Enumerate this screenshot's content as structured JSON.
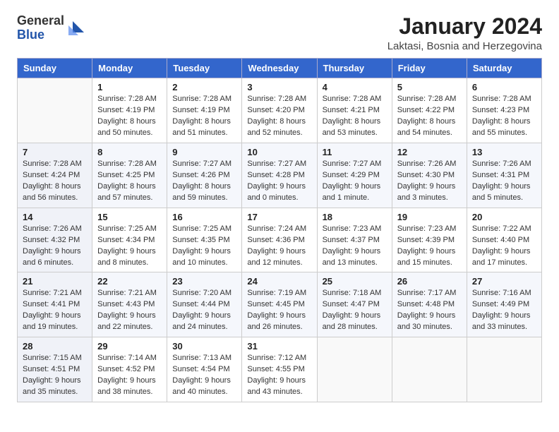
{
  "header": {
    "logo_general": "General",
    "logo_blue": "Blue",
    "title": "January 2024",
    "subtitle": "Laktasi, Bosnia and Herzegovina"
  },
  "days_of_week": [
    "Sunday",
    "Monday",
    "Tuesday",
    "Wednesday",
    "Thursday",
    "Friday",
    "Saturday"
  ],
  "weeks": [
    [
      {
        "day": "",
        "sunrise": "",
        "sunset": "",
        "daylight": ""
      },
      {
        "day": "1",
        "sunrise": "Sunrise: 7:28 AM",
        "sunset": "Sunset: 4:19 PM",
        "daylight": "Daylight: 8 hours and 50 minutes."
      },
      {
        "day": "2",
        "sunrise": "Sunrise: 7:28 AM",
        "sunset": "Sunset: 4:19 PM",
        "daylight": "Daylight: 8 hours and 51 minutes."
      },
      {
        "day": "3",
        "sunrise": "Sunrise: 7:28 AM",
        "sunset": "Sunset: 4:20 PM",
        "daylight": "Daylight: 8 hours and 52 minutes."
      },
      {
        "day": "4",
        "sunrise": "Sunrise: 7:28 AM",
        "sunset": "Sunset: 4:21 PM",
        "daylight": "Daylight: 8 hours and 53 minutes."
      },
      {
        "day": "5",
        "sunrise": "Sunrise: 7:28 AM",
        "sunset": "Sunset: 4:22 PM",
        "daylight": "Daylight: 8 hours and 54 minutes."
      },
      {
        "day": "6",
        "sunrise": "Sunrise: 7:28 AM",
        "sunset": "Sunset: 4:23 PM",
        "daylight": "Daylight: 8 hours and 55 minutes."
      }
    ],
    [
      {
        "day": "7",
        "sunrise": "Sunrise: 7:28 AM",
        "sunset": "Sunset: 4:24 PM",
        "daylight": "Daylight: 8 hours and 56 minutes."
      },
      {
        "day": "8",
        "sunrise": "Sunrise: 7:28 AM",
        "sunset": "Sunset: 4:25 PM",
        "daylight": "Daylight: 8 hours and 57 minutes."
      },
      {
        "day": "9",
        "sunrise": "Sunrise: 7:27 AM",
        "sunset": "Sunset: 4:26 PM",
        "daylight": "Daylight: 8 hours and 59 minutes."
      },
      {
        "day": "10",
        "sunrise": "Sunrise: 7:27 AM",
        "sunset": "Sunset: 4:28 PM",
        "daylight": "Daylight: 9 hours and 0 minutes."
      },
      {
        "day": "11",
        "sunrise": "Sunrise: 7:27 AM",
        "sunset": "Sunset: 4:29 PM",
        "daylight": "Daylight: 9 hours and 1 minute."
      },
      {
        "day": "12",
        "sunrise": "Sunrise: 7:26 AM",
        "sunset": "Sunset: 4:30 PM",
        "daylight": "Daylight: 9 hours and 3 minutes."
      },
      {
        "day": "13",
        "sunrise": "Sunrise: 7:26 AM",
        "sunset": "Sunset: 4:31 PM",
        "daylight": "Daylight: 9 hours and 5 minutes."
      }
    ],
    [
      {
        "day": "14",
        "sunrise": "Sunrise: 7:26 AM",
        "sunset": "Sunset: 4:32 PM",
        "daylight": "Daylight: 9 hours and 6 minutes."
      },
      {
        "day": "15",
        "sunrise": "Sunrise: 7:25 AM",
        "sunset": "Sunset: 4:34 PM",
        "daylight": "Daylight: 9 hours and 8 minutes."
      },
      {
        "day": "16",
        "sunrise": "Sunrise: 7:25 AM",
        "sunset": "Sunset: 4:35 PM",
        "daylight": "Daylight: 9 hours and 10 minutes."
      },
      {
        "day": "17",
        "sunrise": "Sunrise: 7:24 AM",
        "sunset": "Sunset: 4:36 PM",
        "daylight": "Daylight: 9 hours and 12 minutes."
      },
      {
        "day": "18",
        "sunrise": "Sunrise: 7:23 AM",
        "sunset": "Sunset: 4:37 PM",
        "daylight": "Daylight: 9 hours and 13 minutes."
      },
      {
        "day": "19",
        "sunrise": "Sunrise: 7:23 AM",
        "sunset": "Sunset: 4:39 PM",
        "daylight": "Daylight: 9 hours and 15 minutes."
      },
      {
        "day": "20",
        "sunrise": "Sunrise: 7:22 AM",
        "sunset": "Sunset: 4:40 PM",
        "daylight": "Daylight: 9 hours and 17 minutes."
      }
    ],
    [
      {
        "day": "21",
        "sunrise": "Sunrise: 7:21 AM",
        "sunset": "Sunset: 4:41 PM",
        "daylight": "Daylight: 9 hours and 19 minutes."
      },
      {
        "day": "22",
        "sunrise": "Sunrise: 7:21 AM",
        "sunset": "Sunset: 4:43 PM",
        "daylight": "Daylight: 9 hours and 22 minutes."
      },
      {
        "day": "23",
        "sunrise": "Sunrise: 7:20 AM",
        "sunset": "Sunset: 4:44 PM",
        "daylight": "Daylight: 9 hours and 24 minutes."
      },
      {
        "day": "24",
        "sunrise": "Sunrise: 7:19 AM",
        "sunset": "Sunset: 4:45 PM",
        "daylight": "Daylight: 9 hours and 26 minutes."
      },
      {
        "day": "25",
        "sunrise": "Sunrise: 7:18 AM",
        "sunset": "Sunset: 4:47 PM",
        "daylight": "Daylight: 9 hours and 28 minutes."
      },
      {
        "day": "26",
        "sunrise": "Sunrise: 7:17 AM",
        "sunset": "Sunset: 4:48 PM",
        "daylight": "Daylight: 9 hours and 30 minutes."
      },
      {
        "day": "27",
        "sunrise": "Sunrise: 7:16 AM",
        "sunset": "Sunset: 4:49 PM",
        "daylight": "Daylight: 9 hours and 33 minutes."
      }
    ],
    [
      {
        "day": "28",
        "sunrise": "Sunrise: 7:15 AM",
        "sunset": "Sunset: 4:51 PM",
        "daylight": "Daylight: 9 hours and 35 minutes."
      },
      {
        "day": "29",
        "sunrise": "Sunrise: 7:14 AM",
        "sunset": "Sunset: 4:52 PM",
        "daylight": "Daylight: 9 hours and 38 minutes."
      },
      {
        "day": "30",
        "sunrise": "Sunrise: 7:13 AM",
        "sunset": "Sunset: 4:54 PM",
        "daylight": "Daylight: 9 hours and 40 minutes."
      },
      {
        "day": "31",
        "sunrise": "Sunrise: 7:12 AM",
        "sunset": "Sunset: 4:55 PM",
        "daylight": "Daylight: 9 hours and 43 minutes."
      },
      {
        "day": "",
        "sunrise": "",
        "sunset": "",
        "daylight": ""
      },
      {
        "day": "",
        "sunrise": "",
        "sunset": "",
        "daylight": ""
      },
      {
        "day": "",
        "sunrise": "",
        "sunset": "",
        "daylight": ""
      }
    ]
  ]
}
